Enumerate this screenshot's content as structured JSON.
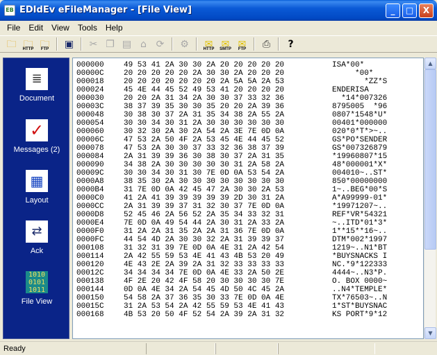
{
  "window": {
    "title": "EDIdEv eFileManager - [File View]",
    "app_icon_text": "EB",
    "minimize_symbol": "_",
    "maximize_symbol": "□",
    "close_symbol": "X"
  },
  "menu": [
    "File",
    "Edit",
    "View",
    "Tools",
    "Help"
  ],
  "toolbar": {
    "open_caption": "",
    "open_http_caption": "HTTP",
    "open_ftp_caption": "FTP",
    "send_http_caption": "HTTP",
    "send_smtp_caption": "SMTP",
    "send_ftp_caption": "FTP"
  },
  "sidebar": {
    "items": [
      {
        "label": "Document",
        "icon": "document-icon"
      },
      {
        "label": "Messages (2)",
        "icon": "messages-icon"
      },
      {
        "label": "Layout",
        "icon": "layout-icon"
      },
      {
        "label": "Ack",
        "icon": "ack-icon"
      },
      {
        "label": "File View",
        "icon": "binary-file-icon"
      }
    ]
  },
  "hex_rows": [
    {
      "offset": "000000",
      "bytes": "49 53 41 2A 30 30 2A 20 20 20 20 20",
      "ascii": "ISA*00*"
    },
    {
      "offset": "00000C",
      "bytes": "20 20 20 20 20 2A 30 30 2A 20 20 20",
      "ascii": "     *00*"
    },
    {
      "offset": "000018",
      "bytes": "20 20 20 20 20 20 20 2A 5A 5A 2A 53",
      "ascii": "       *ZZ*S"
    },
    {
      "offset": "000024",
      "bytes": "45 4E 44 45 52 49 53 41 20 20 20 20",
      "ascii": "ENDERISA"
    },
    {
      "offset": "000030",
      "bytes": "20 20 2A 31 34 2A 30 30 37 33 32 36",
      "ascii": "  *14*007326"
    },
    {
      "offset": "00003C",
      "bytes": "38 37 39 35 30 30 35 20 20 2A 39 36",
      "ascii": "8795005  *96"
    },
    {
      "offset": "000048",
      "bytes": "30 38 30 37 2A 31 35 34 38 2A 55 2A",
      "ascii": "0807*1548*U*"
    },
    {
      "offset": "000054",
      "bytes": "30 30 34 30 31 2A 30 30 30 30 30 30",
      "ascii": "00401*000000"
    },
    {
      "offset": "000060",
      "bytes": "30 32 30 2A 30 2A 54 2A 3E 7E 0D 0A",
      "ascii": "020*0*T*>~.."
    },
    {
      "offset": "00006C",
      "bytes": "47 53 2A 50 4F 2A 53 45 4E 44 45 52",
      "ascii": "GS*PO*SENDER"
    },
    {
      "offset": "000078",
      "bytes": "47 53 2A 30 30 37 33 32 36 38 37 39",
      "ascii": "GS*007326879"
    },
    {
      "offset": "000084",
      "bytes": "2A 31 39 39 36 30 38 30 37 2A 31 35",
      "ascii": "*19960807*15"
    },
    {
      "offset": "000090",
      "bytes": "34 38 2A 30 30 30 30 30 31 2A 58 2A",
      "ascii": "48*000001*X*"
    },
    {
      "offset": "00009C",
      "bytes": "30 30 34 30 31 30 7E 0D 0A 53 54 2A",
      "ascii": "004010~..ST*"
    },
    {
      "offset": "0000A8",
      "bytes": "38 35 30 2A 30 30 30 30 30 30 30 30",
      "ascii": "850*00000000"
    },
    {
      "offset": "0000B4",
      "bytes": "31 7E 0D 0A 42 45 47 2A 30 30 2A 53",
      "ascii": "1~..BEG*00*S"
    },
    {
      "offset": "0000C0",
      "bytes": "41 2A 41 39 39 39 39 39 2D 30 31 2A",
      "ascii": "A*A99999-01*"
    },
    {
      "offset": "0000CC",
      "bytes": "2A 31 39 39 37 31 32 30 37 7E 0D 0A",
      "ascii": "*19971207~.."
    },
    {
      "offset": "0000D8",
      "bytes": "52 45 46 2A 56 52 2A 35 34 33 32 31",
      "ascii": "REF*VR*54321"
    },
    {
      "offset": "0000E4",
      "bytes": "7E 0D 0A 49 54 44 2A 30 31 2A 33 2A",
      "ascii": "~..ITD*01*3*"
    },
    {
      "offset": "0000F0",
      "bytes": "31 2A 2A 31 35 2A 2A 31 36 7E 0D 0A",
      "ascii": "1**15**16~.."
    },
    {
      "offset": "0000FC",
      "bytes": "44 54 4D 2A 30 30 32 2A 31 39 39 37",
      "ascii": "DTM*002*1997"
    },
    {
      "offset": "000108",
      "bytes": "31 32 31 39 7E 0D 0A 4E 31 2A 42 54",
      "ascii": "1219~..N1*BT"
    },
    {
      "offset": "000114",
      "bytes": "2A 42 55 59 53 4E 41 43 4B 53 20 49",
      "ascii": "*BUYSNACKS I"
    },
    {
      "offset": "000120",
      "bytes": "4E 43 2E 2A 39 2A 31 32 33 33 33 33",
      "ascii": "NC.*9*122333"
    },
    {
      "offset": "00012C",
      "bytes": "34 34 34 34 7E 0D 0A 4E 33 2A 50 2E",
      "ascii": "4444~..N3*P."
    },
    {
      "offset": "000138",
      "bytes": "4F 2E 20 42 4F 58 20 30 30 30 30 7E",
      "ascii": "O. BOX 0000~"
    },
    {
      "offset": "000144",
      "bytes": "0D 0A 4E 34 2A 54 45 4D 50 4C 45 2A",
      "ascii": "..N4*TEMPLE*"
    },
    {
      "offset": "000150",
      "bytes": "54 58 2A 37 36 35 30 33 7E 0D 0A 4E",
      "ascii": "TX*76503~..N"
    },
    {
      "offset": "00015C",
      "bytes": "31 2A 53 54 2A 42 55 59 53 4E 41 43",
      "ascii": "1*ST*BUYSNAC"
    },
    {
      "offset": "000168",
      "bytes": "4B 53 20 50 4F 52 54 2A 39 2A 31 32",
      "ascii": "KS PORT*9*12"
    }
  ],
  "status": {
    "text": "Ready"
  },
  "colors": {
    "sidebar_bg": "#0a2488",
    "titlebar": "#0b5ad6"
  }
}
